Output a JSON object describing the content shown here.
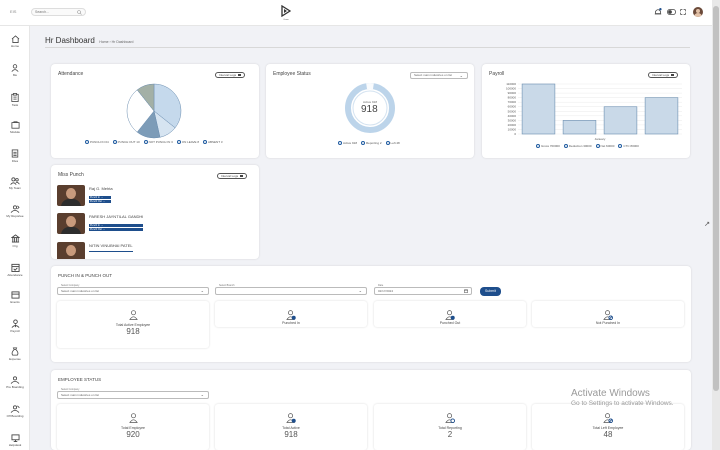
{
  "topbar": {
    "left_badge": "EIS",
    "search_placeholder": "Search...",
    "logo_text": "Oraan"
  },
  "sidebar": {
    "items": [
      {
        "label": "Home",
        "icon": "home-icon"
      },
      {
        "label": "Me",
        "icon": "user-icon"
      },
      {
        "label": "Task",
        "icon": "task-icon"
      },
      {
        "label": "Module",
        "icon": "module-icon"
      },
      {
        "label": "Files",
        "icon": "files-icon"
      },
      {
        "label": "My Team",
        "icon": "team-icon"
      },
      {
        "label": "My Reportee",
        "icon": "reportee-icon"
      },
      {
        "label": "Org",
        "icon": "org-icon"
      },
      {
        "label": "Attendance",
        "icon": "attendance-icon"
      },
      {
        "label": "Events",
        "icon": "events-icon"
      },
      {
        "label": "Payroll",
        "icon": "payroll-icon"
      },
      {
        "label": "Expense",
        "icon": "expense-icon"
      },
      {
        "label": "Pre Boarding",
        "icon": "preboarding-icon"
      },
      {
        "label": "Off Boarding",
        "icon": "offboarding-icon"
      },
      {
        "label": "Helpdesk",
        "icon": "helpdesk-icon"
      }
    ]
  },
  "page": {
    "title": "Hr Dashboard",
    "breadcrumb": "Home  ›  Hr Dashboard"
  },
  "attendance": {
    "title": "Attendance",
    "button": "Interval Logs",
    "legend": [
      "PUNCH IN 04",
      "PUNCH OUT 10",
      "NOT PUNCH IN 3",
      "ON LEAVE 8",
      "ABSENT 3"
    ],
    "chart_data": {
      "type": "pie",
      "labels": [
        "PUNCH IN",
        "PUNCH OUT",
        "NOT PUNCH IN",
        "ON LEAVE",
        "ABSENT"
      ],
      "values": [
        4,
        10,
        3,
        8,
        3
      ],
      "colors": [
        "#7d9cb8",
        "#c5d9ec",
        "#a3b0a6",
        "#ffffff",
        "#d6e4f1"
      ]
    }
  },
  "employee_status": {
    "title": "Employee Status",
    "select": "Select main industries on list",
    "center_label": "Active 918",
    "center_value": "918",
    "legend": [
      "Active 918",
      "Reporting 2",
      "Left 48"
    ],
    "chart_data": {
      "type": "pie",
      "labels": [
        "Active",
        "Reporting",
        "Left"
      ],
      "values": [
        918,
        2,
        48
      ]
    }
  },
  "payroll": {
    "title": "Payroll",
    "button": "Interval Logs",
    "legend": [
      "Gross 700000",
      "Deduction 30000",
      "Net 60000",
      "CTC 80000"
    ],
    "chart_data": {
      "type": "bar",
      "xlabel": "January",
      "categories": [
        "Gross",
        "Deduction",
        "Net",
        "CTC"
      ],
      "values": [
        700000,
        30000,
        60000,
        80000
      ],
      "yticks": [
        "110000",
        "100000",
        "90000",
        "80000",
        "70000",
        "60000",
        "50000",
        "40000",
        "30000",
        "20000",
        "10000",
        "0"
      ],
      "ylim": [
        0,
        110000
      ]
    }
  },
  "miss_punch": {
    "title": "Miss Punch",
    "button": "Interval Logs",
    "people": [
      {
        "name": "Raj G. Mehta",
        "tags": [
          "Punch In →",
          "Punch Out →"
        ]
      },
      {
        "name": "PARESH JAYNTILAL GANDHI",
        "tags": [
          "Punch In →",
          "Punch Out →"
        ]
      },
      {
        "name": "NITIN VINUBHAI PATEL",
        "tags": []
      }
    ]
  },
  "punch": {
    "title": "PUNCH IN & PUNCH OUT",
    "company_label": "Select Company",
    "company_value": "Select main industries on list",
    "branch_label": "Select Branch",
    "branch_value": "",
    "date_label": "Date",
    "date_value": "02/17/2024",
    "submit": "Submit",
    "stats": [
      {
        "label": "Total Active Employee",
        "value": "918"
      },
      {
        "label": "Punched In",
        "value": ""
      },
      {
        "label": "Punched Out",
        "value": ""
      },
      {
        "label": "Not Punched In",
        "value": ""
      }
    ]
  },
  "emp_status": {
    "title": "EMPLOYEE STATUS",
    "company_label": "Select Company",
    "company_value": "Select main industries on list",
    "stats": [
      {
        "label": "Total Employee",
        "value": "920"
      },
      {
        "label": "Total Active",
        "value": "918"
      },
      {
        "label": "Total Reporting",
        "value": "2"
      },
      {
        "label": "Total Left Employee",
        "value": "48"
      }
    ]
  },
  "watermark": {
    "line1": "Activate Windows",
    "line2": "Go to Settings to activate Windows."
  },
  "colors": {
    "accent": "#1e4e8c",
    "chart_fill": "#c9d9e8",
    "chart_stroke": "#6c8eb0"
  }
}
